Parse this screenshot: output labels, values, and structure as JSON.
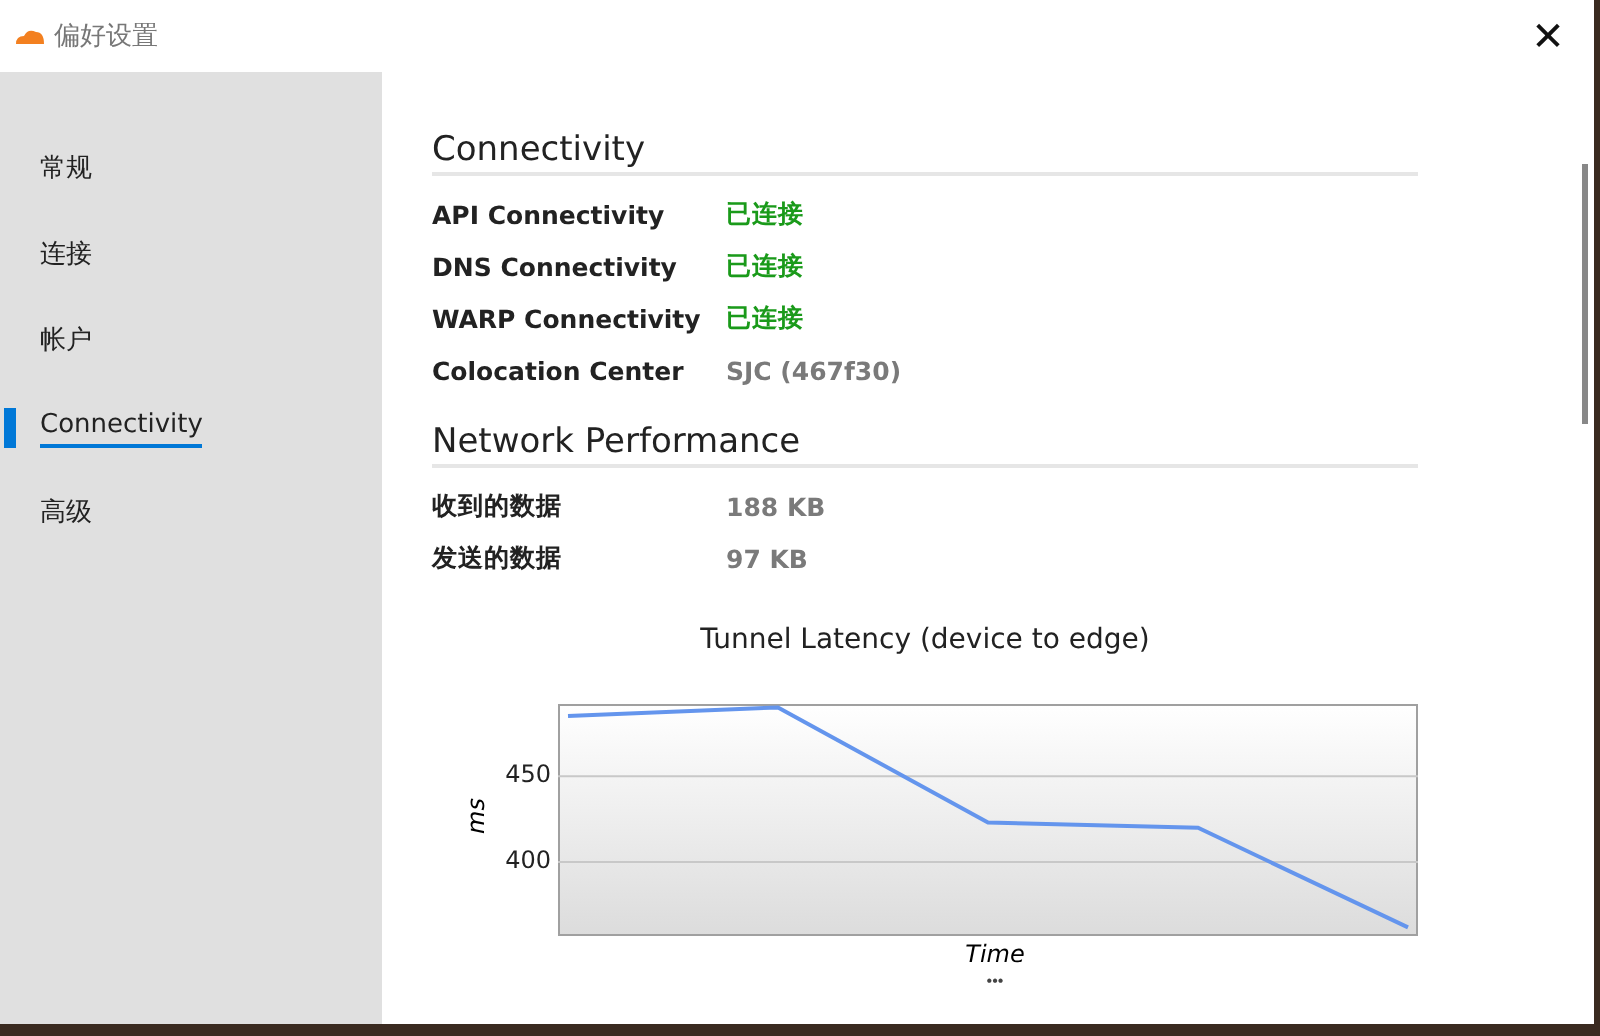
{
  "window": {
    "title": "偏好设置",
    "close": "✕"
  },
  "sidebar": {
    "items": [
      {
        "label": "常规",
        "selected": false
      },
      {
        "label": "连接",
        "selected": false
      },
      {
        "label": "帐户",
        "selected": false
      },
      {
        "label": "Connectivity",
        "selected": true
      },
      {
        "label": "高级",
        "selected": false
      }
    ]
  },
  "sections": [
    {
      "title": "Connectivity",
      "rows": [
        {
          "label": "API Connectivity",
          "value": "已连接",
          "kind": "status"
        },
        {
          "label": "DNS Connectivity",
          "value": "已连接",
          "kind": "status"
        },
        {
          "label": "WARP Connectivity",
          "value": "已连接",
          "kind": "status"
        },
        {
          "label": "Colocation Center",
          "value": "SJC (467f30)",
          "kind": "text"
        }
      ]
    },
    {
      "title": "Network Performance",
      "rows": [
        {
          "label": "收到的数据",
          "value": "188 KB",
          "kind": "text"
        },
        {
          "label": "发送的数据",
          "value": "97 KB",
          "kind": "text"
        }
      ]
    }
  ],
  "chart": {
    "chart_data": {
      "type": "line",
      "title": "Tunnel Latency (device to edge)",
      "xlabel": "Time",
      "ylabel": "ms",
      "values": [
        485,
        490,
        423,
        420,
        362
      ],
      "ylim": [
        357,
        492
      ],
      "yticks": [
        400,
        450
      ]
    },
    "more": "•••"
  }
}
